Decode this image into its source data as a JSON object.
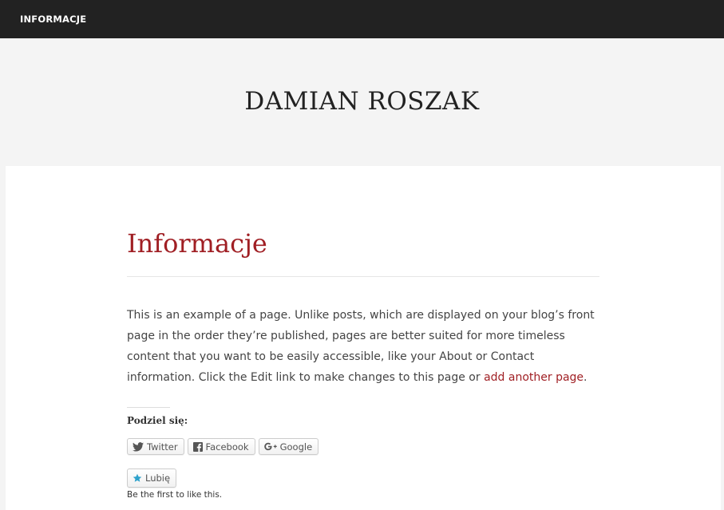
{
  "topnav": {
    "menu_item": "INFORMACJE"
  },
  "header": {
    "site_title": "DAMIAN ROSZAK"
  },
  "entry": {
    "title": "Informacje",
    "body_text": "This is an example of a page. Unlike posts, which are displayed on your blog’s front page in the order they’re published, pages are better suited for more timeless content that you want to be easily accessible, like your About or Contact information. Click the Edit link to make changes to this page or ",
    "body_link": "add another page",
    "body_end": "."
  },
  "share": {
    "heading": "Podziel się:",
    "buttons": [
      {
        "label": "Twitter",
        "icon": "twitter-icon"
      },
      {
        "label": "Facebook",
        "icon": "facebook-icon"
      },
      {
        "label": "Google",
        "icon": "google-plus-icon"
      }
    ]
  },
  "like": {
    "button_label": "Lubię",
    "icon": "star-icon",
    "note": "Be the first to like this."
  },
  "colors": {
    "accent": "#a01f24",
    "nav_bg": "#222222",
    "page_bg": "#f4f4f4",
    "like_star": "#2ea2cc"
  }
}
